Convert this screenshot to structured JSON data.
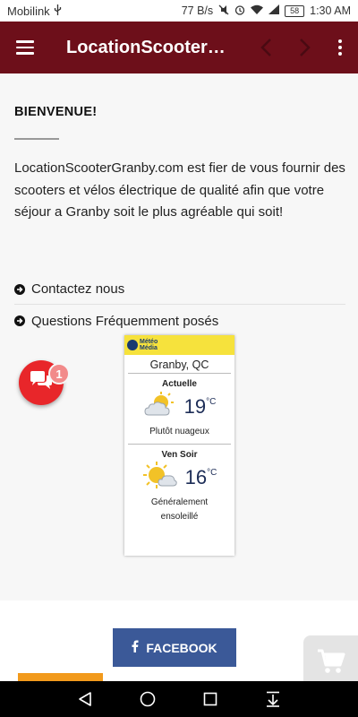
{
  "status_bar": {
    "carrier": "Mobilink",
    "network_speed": "77 B/s",
    "battery_level": "58",
    "time": "1:30 AM"
  },
  "app_bar": {
    "title": "LocationScooterGranby.com",
    "menu_icon": "hamburger-menu-icon",
    "back_icon": "chevron-left-icon",
    "forward_icon": "chevron-right-icon",
    "more_icon": "more-vertical-icon",
    "color": "#6d0f1a"
  },
  "main": {
    "welcome_title": "BIENVENUE!",
    "intro_text": "LocationScooterGranby.com est fier de vous fournir des scooters et vélos électrique de qualité afin que votre séjour a Granby soit le plus agréable qui soit!",
    "links": [
      {
        "label": "Contactez nous",
        "icon": "arrow-circle-right-icon"
      },
      {
        "label": "Questions Fréquemment posés",
        "icon": "arrow-circle-right-icon"
      }
    ]
  },
  "chat": {
    "icon": "chat-bubbles-icon",
    "badge_count": "1",
    "color": "#e8262a"
  },
  "weather": {
    "brand_line1": "Météo",
    "brand_line2": "Média",
    "city": "Granby, QC",
    "current": {
      "period": "Actuelle",
      "temp": "19",
      "unit": "°C",
      "condition": "Plutôt nuageux",
      "icon": "partly-cloudy-sun-icon"
    },
    "evening": {
      "period": "Ven Soir",
      "temp": "16",
      "unit": "°C",
      "condition": "Généralement ensoleillé",
      "icon": "sun-cloud-icon"
    }
  },
  "footer": {
    "facebook_label": "FACEBOOK",
    "facebook_color": "#3b5998",
    "cart_icon": "shopping-cart-icon"
  },
  "android_nav": {
    "back_icon": "triangle-back-icon",
    "home_icon": "circle-home-icon",
    "recents_icon": "square-recents-icon",
    "notifications_icon": "pull-down-icon"
  }
}
